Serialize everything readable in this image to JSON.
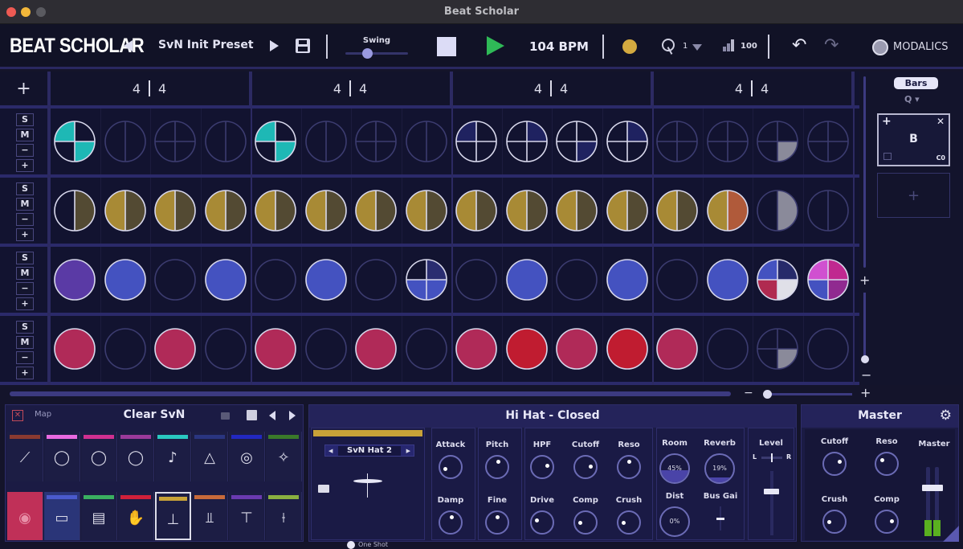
{
  "window": {
    "title": "Beat Scholar"
  },
  "topbar": {
    "logo": "BEAT SCHOLAR",
    "preset_name": "SvN Init Preset",
    "swing_label": "Swing",
    "swing_value": 0.35,
    "tempo": "104 BPM",
    "quantize_value": "1",
    "velocity_value": "100",
    "brand": "MODALICS"
  },
  "sequencer": {
    "time_signatures": [
      "4 | 4",
      "4 | 4",
      "4 | 4",
      "4 | 4"
    ],
    "row_controls": [
      "S",
      "M",
      "−",
      "+"
    ],
    "add_track_label": "+",
    "rows": [
      {
        "name": "track-1",
        "steps": [
          {
            "type": "quad",
            "fills": [
              "#1eb8b5",
              null,
              null,
              "#1eb8b5"
            ],
            "active": true
          },
          {
            "type": "half",
            "fills": [
              null,
              null
            ],
            "active": false
          },
          {
            "type": "quad",
            "fills": [
              null,
              null,
              null,
              null
            ],
            "active": false
          },
          {
            "type": "half",
            "fills": [
              null,
              null
            ],
            "active": false
          },
          {
            "type": "quad",
            "fills": [
              "#1eb8b5",
              null,
              null,
              "#1eb8b5"
            ],
            "active": true
          },
          {
            "type": "half",
            "fills": [
              null,
              null
            ],
            "active": false
          },
          {
            "type": "quad",
            "fills": [
              null,
              null,
              null,
              null
            ],
            "active": false
          },
          {
            "type": "half",
            "fills": [
              null,
              null
            ],
            "active": false
          },
          {
            "type": "quad",
            "fills": [
              "#1f2260",
              null,
              null,
              null
            ],
            "active": true
          },
          {
            "type": "quad",
            "fills": [
              null,
              "#1f2260",
              null,
              null
            ],
            "active": true
          },
          {
            "type": "quad",
            "fills": [
              null,
              null,
              null,
              "#1f2260"
            ],
            "active": true
          },
          {
            "type": "quad",
            "fills": [
              null,
              "#1f2260",
              null,
              null
            ],
            "active": true
          },
          {
            "type": "quad",
            "fills": [
              null,
              null,
              null,
              null
            ],
            "active": false
          },
          {
            "type": "quad",
            "fills": [
              null,
              null,
              null,
              null
            ],
            "active": false
          },
          {
            "type": "quad",
            "fills": [
              null,
              null,
              null,
              "#8a8a9a"
            ],
            "active": false
          },
          {
            "type": "quad",
            "fills": [
              null,
              null,
              null,
              null
            ],
            "active": false
          }
        ]
      },
      {
        "name": "track-2",
        "steps": [
          {
            "type": "half",
            "fills": [
              null,
              "#534a33"
            ],
            "active": true
          },
          {
            "type": "half",
            "fills": [
              "#a88a35",
              "#534a33"
            ],
            "active": true
          },
          {
            "type": "half",
            "fills": [
              "#a88a35",
              "#534a33"
            ],
            "active": true
          },
          {
            "type": "half",
            "fills": [
              "#a88a35",
              "#534a33"
            ],
            "active": true
          },
          {
            "type": "half",
            "fills": [
              "#a88a35",
              "#534a33"
            ],
            "active": true
          },
          {
            "type": "half",
            "fills": [
              "#a88a35",
              "#534a33"
            ],
            "active": true
          },
          {
            "type": "half",
            "fills": [
              "#a88a35",
              "#534a33"
            ],
            "active": true
          },
          {
            "type": "half",
            "fills": [
              "#a88a35",
              "#534a33"
            ],
            "active": true
          },
          {
            "type": "half",
            "fills": [
              "#a88a35",
              "#534a33"
            ],
            "active": true
          },
          {
            "type": "half",
            "fills": [
              "#a88a35",
              "#534a33"
            ],
            "active": true
          },
          {
            "type": "half",
            "fills": [
              "#a88a35",
              "#534a33"
            ],
            "active": true
          },
          {
            "type": "half",
            "fills": [
              "#a88a35",
              "#534a33"
            ],
            "active": true
          },
          {
            "type": "half",
            "fills": [
              "#a88a35",
              "#534a33"
            ],
            "active": true
          },
          {
            "type": "half",
            "fills": [
              "#a88a35",
              "#b05a3a"
            ],
            "active": true
          },
          {
            "type": "half",
            "fills": [
              null,
              "#8a8a9a"
            ],
            "active": false
          },
          {
            "type": "half",
            "fills": [
              null,
              null
            ],
            "active": false
          }
        ]
      },
      {
        "name": "track-3",
        "steps": [
          {
            "type": "full",
            "fills": [
              "#5a3aa5"
            ],
            "active": true
          },
          {
            "type": "full",
            "fills": [
              "#4452c0"
            ],
            "active": true
          },
          {
            "type": "full",
            "fills": [
              null
            ],
            "active": false
          },
          {
            "type": "full",
            "fills": [
              "#4452c0"
            ],
            "active": true
          },
          {
            "type": "full",
            "fills": [
              null
            ],
            "active": false
          },
          {
            "type": "full",
            "fills": [
              "#4452c0"
            ],
            "active": true
          },
          {
            "type": "full",
            "fills": [
              null
            ],
            "active": false
          },
          {
            "type": "quad",
            "fills": [
              null,
              "#2a2d70",
              "#4452c0",
              "#4452c0"
            ],
            "active": true
          },
          {
            "type": "full",
            "fills": [
              null
            ],
            "active": false
          },
          {
            "type": "full",
            "fills": [
              "#4452c0"
            ],
            "active": true
          },
          {
            "type": "full",
            "fills": [
              null
            ],
            "active": false
          },
          {
            "type": "full",
            "fills": [
              "#4452c0"
            ],
            "active": true
          },
          {
            "type": "full",
            "fills": [
              null
            ],
            "active": false
          },
          {
            "type": "full",
            "fills": [
              "#4452c0"
            ],
            "active": true
          },
          {
            "type": "quad",
            "fills": [
              "#4452c0",
              "#262a6a",
              "#b02a50",
              "#e0e0e8"
            ],
            "active": true
          },
          {
            "type": "quad",
            "fills": [
              "#d050d0",
              "#c02890",
              "#4452c0",
              "#902a90"
            ],
            "active": true
          }
        ]
      },
      {
        "name": "track-4",
        "steps": [
          {
            "type": "full",
            "fills": [
              "#b02a58"
            ],
            "active": true
          },
          {
            "type": "full",
            "fills": [
              null
            ],
            "active": false
          },
          {
            "type": "full",
            "fills": [
              "#b02a58"
            ],
            "active": true
          },
          {
            "type": "full",
            "fills": [
              null
            ],
            "active": false
          },
          {
            "type": "full",
            "fills": [
              "#b02a58"
            ],
            "active": true
          },
          {
            "type": "full",
            "fills": [
              null
            ],
            "active": false
          },
          {
            "type": "full",
            "fills": [
              "#b02a58"
            ],
            "active": true
          },
          {
            "type": "full",
            "fills": [
              null
            ],
            "active": false
          },
          {
            "type": "full",
            "fills": [
              "#b02a58"
            ],
            "active": true
          },
          {
            "type": "full",
            "fills": [
              "#c01c30"
            ],
            "active": true
          },
          {
            "type": "full",
            "fills": [
              "#b02a58"
            ],
            "active": true
          },
          {
            "type": "full",
            "fills": [
              "#c01c30"
            ],
            "active": true
          },
          {
            "type": "full",
            "fills": [
              "#b02a58"
            ],
            "active": true
          },
          {
            "type": "full",
            "fills": [
              null
            ],
            "active": false
          },
          {
            "type": "quad",
            "fills": [
              null,
              null,
              null,
              "#8a8a9a"
            ],
            "active": false
          },
          {
            "type": "full",
            "fills": [
              null
            ],
            "active": false
          }
        ]
      }
    ]
  },
  "pattern_panel": {
    "mode_label": "Bars",
    "pattern_name": "B",
    "pattern_note": "C0",
    "add_label": "+"
  },
  "kit_panel": {
    "map_label": "Map",
    "kit_name": "Clear SvN",
    "instruments_top": [
      {
        "name": "cymbal",
        "color": "#8a3a30",
        "icon": "cymbal-icon"
      },
      {
        "name": "drum-kit",
        "color": "#e86ae0",
        "icon": "drum-kit-icon"
      },
      {
        "name": "drum-kit",
        "color": "#d03090",
        "icon": "drum-kit-icon"
      },
      {
        "name": "drum-kit",
        "color": "#9a3a9a",
        "icon": "drum-kit-icon"
      },
      {
        "name": "maracas",
        "color": "#2ac8c0",
        "icon": "maracas-icon"
      },
      {
        "name": "triangle",
        "color": "#2a3580",
        "icon": "triangle-icon"
      },
      {
        "name": "target",
        "color": "#2228c0",
        "icon": "target-icon"
      },
      {
        "name": "sparkles",
        "color": "#3a7a2a",
        "icon": "sparkles-icon"
      }
    ],
    "instruments_bottom": [
      {
        "name": "kick",
        "color": "#c03058",
        "icon": "kick-icon",
        "selected_bg": true
      },
      {
        "name": "snare",
        "color": "#4a5acc",
        "icon": "snare-icon"
      },
      {
        "name": "snare-rim",
        "color": "#3ab060",
        "icon": "snare-rim-icon"
      },
      {
        "name": "clap",
        "color": "#d0203a",
        "icon": "clap-icon"
      },
      {
        "name": "hihat-closed",
        "color": "#c8a238",
        "icon": "hihat-icon",
        "selected": true
      },
      {
        "name": "hihat-open",
        "color": "#c86a3a",
        "icon": "hihat-open-icon"
      },
      {
        "name": "ride",
        "color": "#6a3ab0",
        "icon": "ride-icon"
      },
      {
        "name": "crash",
        "color": "#8ab040",
        "icon": "crash-icon"
      }
    ]
  },
  "instrument_panel": {
    "title": "Hi Hat - Closed",
    "color": "#c8a238",
    "sample_name": "SvN Hat 2",
    "one_shot_label": "One Shot",
    "knobs": [
      {
        "label": "Attack",
        "value": 0.1
      },
      {
        "label": "Pitch",
        "value": 0.55
      },
      {
        "label": "HPF",
        "value": 0.8
      },
      {
        "label": "Cutoff",
        "value": 0.82
      },
      {
        "label": "Reso",
        "value": 0.5
      },
      {
        "label": "Damp",
        "value": 0.55
      },
      {
        "label": "Fine",
        "value": 0.5
      },
      {
        "label": "Drive",
        "value": 0.25
      },
      {
        "label": "Comp",
        "value": 0.15
      },
      {
        "label": "Crush",
        "value": 0.15
      }
    ],
    "sends": [
      {
        "label": "Room",
        "display": "45%",
        "value": 0.45
      },
      {
        "label": "Reverb",
        "display": "19%",
        "value": 0.19
      },
      {
        "label": "Dist",
        "display": "0%",
        "value": 0
      }
    ],
    "bus_gain_label": "Bus Gai",
    "level_label": "Level",
    "pan_left": "L",
    "pan_right": "R",
    "pan_value": 0.5,
    "level_value": 0.72
  },
  "master_panel": {
    "title": "Master",
    "knobs": [
      {
        "label": "Cutoff",
        "value": 0.75
      },
      {
        "label": "Reso",
        "value": 0.3
      },
      {
        "label": "Crush",
        "value": 0.15
      },
      {
        "label": "Comp",
        "value": 0.82
      }
    ],
    "fader_label": "Master",
    "fader_value": 0.75
  }
}
